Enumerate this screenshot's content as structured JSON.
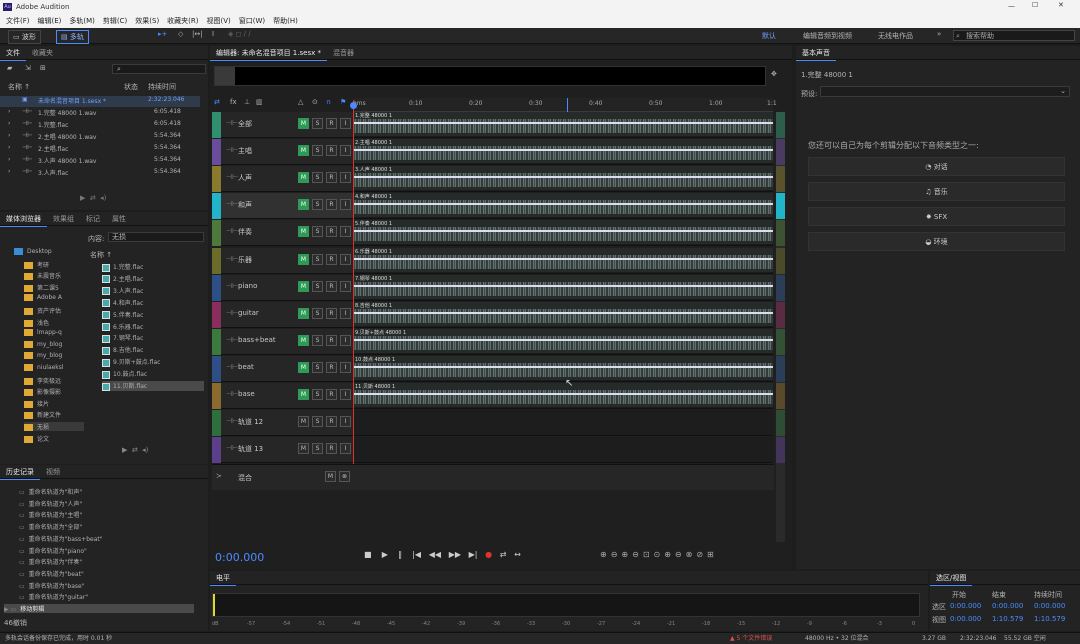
{
  "titlebar": {
    "title": "Adobe Audition"
  },
  "menu": [
    "文件(F)",
    "编辑(E)",
    "多轨(M)",
    "剪辑(C)",
    "效果(S)",
    "收藏夹(R)",
    "视图(V)",
    "窗口(W)",
    "帮助(H)"
  ],
  "toolbar": {
    "waveform": "波形",
    "multitrack": "多轨",
    "workspace": "默认",
    "edit_audio": "编辑音频到视频",
    "radio": "无线电作品",
    "search_placeholder": "搜索帮助"
  },
  "files_panel": {
    "tab_files": "文件",
    "tab_favorites": "收藏夹",
    "col_name": "名称 ↑",
    "col_status": "状态",
    "col_duration": "持续时间",
    "rows": [
      {
        "name": "未命名混音项目 1.sesx *",
        "dur": "2:32:23.046"
      },
      {
        "name": "1.完整 48000 1.wav",
        "dur": "6:05.418"
      },
      {
        "name": "1.完整.flac",
        "dur": "6:05.418"
      },
      {
        "name": "2.主唱 48000 1.wav",
        "dur": "5:54.364"
      },
      {
        "name": "2.主唱.flac",
        "dur": "5:54.364"
      },
      {
        "name": "3.人声 48000 1.wav",
        "dur": "5:54.364"
      },
      {
        "name": "3.人声.flac",
        "dur": "5:54.364"
      }
    ]
  },
  "media_panel": {
    "tab_media": "媒体浏览器",
    "tab_effects": "效果组",
    "tab_markers": "标记",
    "tab_props": "属性",
    "content_label": "内容:",
    "content_value": "无损",
    "col_name": "名称 ↑",
    "folders": [
      "Desktop",
      "考研",
      "未震音乐",
      "第二课5",
      "Adobe A",
      "资产评估",
      "浅色",
      "lmapp-q",
      "my_blog",
      "my_blog",
      "niulaeksl",
      "李奕极远",
      "影像摄影",
      "接片",
      "新建文件",
      "无损",
      "论文"
    ],
    "files": [
      "1.完整.flac",
      "2.主唱.flac",
      "3.人声.flac",
      "4.和声.flac",
      "5.伴奏.flac",
      "6.乐器.flac",
      "7.钢琴.flac",
      "8.吉他.flac",
      "9.贝斯+鼓点.flac",
      "10.鼓点.flac",
      "11.贝斯.flac"
    ]
  },
  "history_panel": {
    "tab_history": "历史记录",
    "tab_video": "视频",
    "items": [
      "重命名轨道为\"和声\"",
      "重命名轨道为\"人声\"",
      "重命名轨道为\"主唱\"",
      "重命名轨道为\"全部\"",
      "重命名轨道为\"bass+beat\"",
      "重命名轨道为\"piano\"",
      "重命名轨道为\"伴奏\"",
      "重命名轨道为\"beat\"",
      "重命名轨道为\"base\"",
      "重命名轨道为\"guitar\"",
      "移动剪辑"
    ],
    "count": "46撤销"
  },
  "editor": {
    "tab_editor": "编辑器: 未命名混音项目 1.sesx *",
    "tab_mixer": "混音器",
    "ruler": [
      "hms",
      "0:10",
      "0:20",
      "0:30",
      "0:40",
      "0:50",
      "1:00",
      "1:1"
    ],
    "time": "0:00.000",
    "tracks": [
      {
        "name": "全部",
        "clip": "1.完整 48000 1",
        "color": "#2f8f6e"
      },
      {
        "name": "主唱",
        "clip": "2.主唱 48000 1",
        "color": "#6a4c9c"
      },
      {
        "name": "人声",
        "clip": "3.人声 48000 1",
        "color": "#8a7a2e"
      },
      {
        "name": "和声",
        "clip": "4.和声 48000 1",
        "color": "#22b4c8"
      },
      {
        "name": "伴奏",
        "clip": "5.伴奏 48000 1",
        "color": "#4d7a3a"
      },
      {
        "name": "乐器",
        "clip": "6.乐器 48000 1",
        "color": "#6b6b2a"
      },
      {
        "name": "piano",
        "clip": "7.钢琴 48000 1",
        "color": "#2e4f86"
      },
      {
        "name": "guitar",
        "clip": "8.吉他 48000 1",
        "color": "#8a2e5e"
      },
      {
        "name": "bass+beat",
        "clip": "9.贝斯+鼓点 48000 1",
        "color": "#3b7a3f"
      },
      {
        "name": "beat",
        "clip": "10.鼓点 48000 1",
        "color": "#2e4f86"
      },
      {
        "name": "base",
        "clip": "11.贝斯 48000 1",
        "color": "#8a6a2e"
      },
      {
        "name": "轨道 12",
        "clip": "",
        "color": "#2f6f3e"
      },
      {
        "name": "轨道 13",
        "clip": "",
        "color": "#5c3f8a"
      }
    ],
    "mix": "混合"
  },
  "essential": {
    "title": "基本声音",
    "clip": "1.完整 48000 1",
    "preset": "预设:",
    "prompt": "您还可以自己为每个剪辑分配以下音频类型之一:",
    "types": [
      "对话",
      "音乐",
      "SFX",
      "环境"
    ]
  },
  "levels": {
    "title": "电平",
    "scale": [
      "dB",
      "-57",
      "-54",
      "-51",
      "-48",
      "-45",
      "-42",
      "-39",
      "-36",
      "-33",
      "-30",
      "-27",
      "-24",
      "-21",
      "-18",
      "-15",
      "-12",
      "-9",
      "-6",
      "-3",
      "0"
    ]
  },
  "selection": {
    "title": "选区/视图",
    "start": "开始",
    "end": "结束",
    "duration": "持续时间",
    "sel_label": "选区",
    "view_label": "视图",
    "sel": [
      "0:00.000",
      "0:00.000",
      "0:00.000"
    ],
    "view": [
      "0:00.000",
      "1:10.579",
      "1:10.579"
    ]
  },
  "status": {
    "left": "多轨会话备份保存已完成，用时 0.01 秒",
    "warn": "5 个文件错误",
    "rate": "48000 Hz • 32 位混合",
    "size": "3.27 GB",
    "dur": "2:32:23.046",
    "free": "55.52 GB 空闲"
  }
}
